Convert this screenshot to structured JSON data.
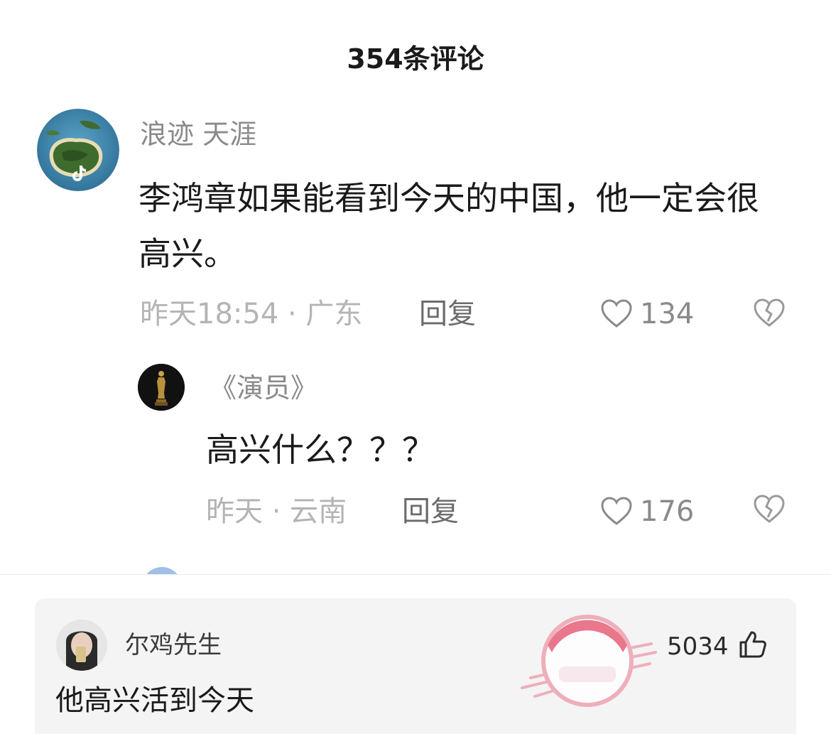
{
  "panel": {
    "title": "354条评论"
  },
  "comment": {
    "username": "浪迹 天涯",
    "text": "李鸿章如果能看到今天的中国，他一定会很高兴。",
    "meta": "昨天18:54 · 广东",
    "reply_label": "回复",
    "likes": "134",
    "avatar_icon": "tiktok-logo-icon"
  },
  "reply": {
    "username": "《演员》",
    "text": "高兴什么？？？",
    "meta": "昨天 · 云南",
    "reply_label": "回复",
    "likes": "176"
  },
  "featured": {
    "username": "尔鸡先生",
    "text": "他高兴活到今天",
    "likes": "5034",
    "stamp_label": "神评",
    "stamp_color": "#e8627a"
  },
  "icons": {
    "like": "heart-outline-icon",
    "dislike": "broken-heart-icon",
    "thumbs_up": "thumbs-up-icon"
  }
}
